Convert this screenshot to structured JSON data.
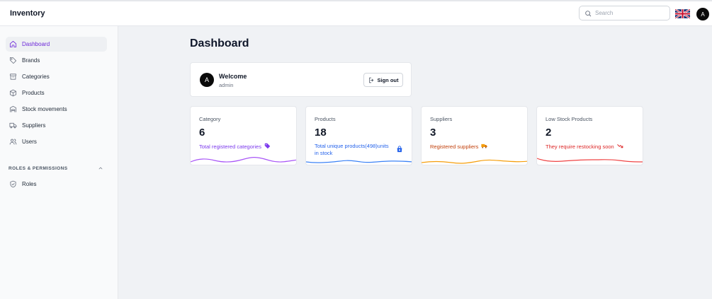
{
  "app": {
    "title": "Inventory"
  },
  "header": {
    "search_placeholder": "Search",
    "language_flag": "uk-flag-icon",
    "avatar_initial": "A"
  },
  "sidebar": {
    "items": [
      {
        "label": "Dashboard",
        "icon": "home-icon",
        "active": true
      },
      {
        "label": "Brands",
        "icon": "tag-icon"
      },
      {
        "label": "Categories",
        "icon": "archive-icon"
      },
      {
        "label": "Products",
        "icon": "package-icon"
      },
      {
        "label": "Stock movements",
        "icon": "warehouse-icon"
      },
      {
        "label": "Suppliers",
        "icon": "truck-icon"
      },
      {
        "label": "Users",
        "icon": "users-icon"
      }
    ],
    "section": {
      "title": "ROLES & PERMISSIONS",
      "icon": "chevron-up-icon"
    },
    "section_items": [
      {
        "label": "Roles",
        "icon": "shield-icon"
      }
    ]
  },
  "main": {
    "title": "Dashboard",
    "welcome": {
      "avatar_initial": "A",
      "title": "Welcome",
      "username": "admin",
      "signout_label": "Sign out"
    },
    "stats": [
      {
        "label": "Category",
        "value": "6",
        "note": "Total registered categories",
        "icon": "tag-icon",
        "color": "#7c3aed",
        "wave_color": "#a855f7"
      },
      {
        "label": "Products",
        "value": "18",
        "note": "Total unique products(498)units in stock",
        "icon": "shopping-bag-icon",
        "color": "#2563eb",
        "wave_color": "#3b82f6"
      },
      {
        "label": "Suppliers",
        "value": "3",
        "note": "Registered suppliers",
        "icon": "truck-icon",
        "color": "#c2410c",
        "wave_color": "#f59e0b"
      },
      {
        "label": "Low Stock Products",
        "value": "2",
        "note": "They require restocking soon",
        "icon": "trending-down-icon",
        "color": "#dc2626",
        "wave_color": "#ef4444"
      }
    ]
  },
  "colors": {
    "accent": "#6d28d9",
    "background": "#f0f2f5",
    "sidebar_bg": "#f9fafb"
  }
}
